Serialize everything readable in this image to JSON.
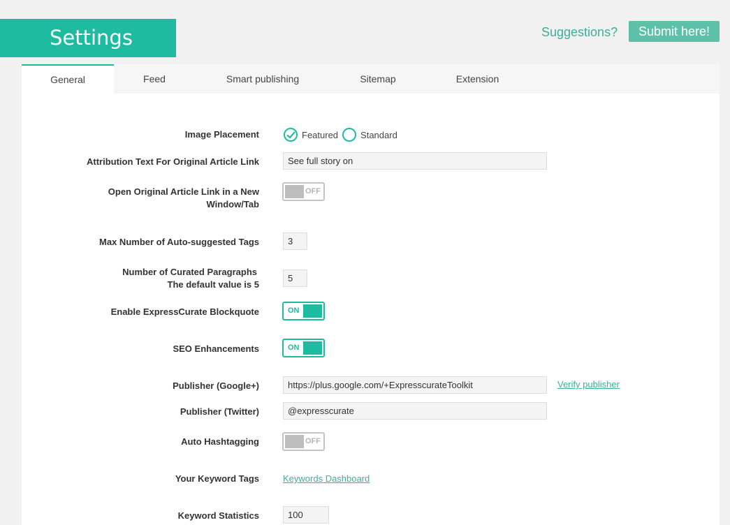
{
  "header": {
    "title": "Settings",
    "suggestions_text": "Suggestions?",
    "submit_label": "Submit here!"
  },
  "tabs": [
    {
      "label": "General",
      "active": true
    },
    {
      "label": "Feed",
      "active": false
    },
    {
      "label": "Smart publishing",
      "active": false
    },
    {
      "label": "Sitemap",
      "active": false
    },
    {
      "label": "Extension",
      "active": false
    }
  ],
  "settings": {
    "image_placement": {
      "label": "Image Placement",
      "options": [
        "Featured",
        "Standard"
      ],
      "selected": "Featured"
    },
    "attribution_text": {
      "label": "Attribution Text For Original Article Link",
      "value": "See full story on"
    },
    "open_new_window": {
      "label_line1": "Open Original Article Link in a New",
      "label_line2": "Window/Tab",
      "state": "OFF"
    },
    "max_tags": {
      "label": "Max Number of Auto-suggested Tags",
      "value": "3"
    },
    "curated_paragraphs": {
      "label_line1": "Number of Curated Paragraphs",
      "label_line2": "The default value is 5",
      "value": "5"
    },
    "blockquote": {
      "label": "Enable ExpressCurate Blockquote",
      "state": "ON"
    },
    "seo": {
      "label": "SEO Enhancements",
      "state": "ON"
    },
    "publisher_google": {
      "label": "Publisher (Google+)",
      "value": "https://plus.google.com/+ExpresscurateToolkit",
      "link": "Verify publisher"
    },
    "publisher_twitter": {
      "label": "Publisher (Twitter)",
      "value": "@expresscurate"
    },
    "auto_hashtag": {
      "label": "Auto Hashtagging",
      "state": "OFF"
    },
    "keyword_tags": {
      "label": "Your Keyword Tags",
      "link": "Keywords Dashboard"
    },
    "keyword_statistics": {
      "label": "Keyword Statistics",
      "value": "100"
    }
  },
  "colors": {
    "accent": "#1fbba0",
    "link": "#3fae97",
    "button": "#5ec0a8"
  }
}
